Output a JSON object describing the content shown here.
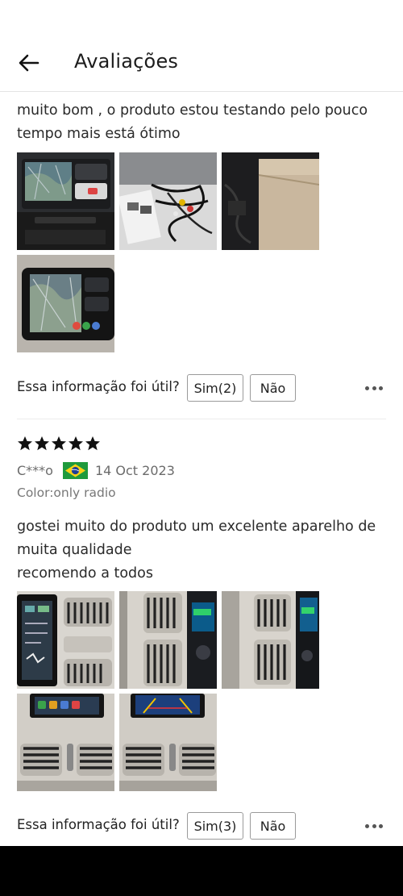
{
  "header": {
    "back_icon": "arrow-left-icon",
    "title": "Avaliações"
  },
  "review1": {
    "text_lines": [
      "muito bom , o produto estou testando pelo pouco",
      "tempo mais está ótimo"
    ],
    "photo_count": 4,
    "helpful": {
      "question": "Essa informação foi útil?",
      "yes_label": "Sim(2)",
      "no_label": "Não",
      "more_icon": "more-horizontal-icon"
    }
  },
  "review2": {
    "rating": 5,
    "reviewer": "C***o",
    "country_flag": "brazil-flag-icon",
    "date": "14 Oct 2023",
    "variant": "Color:only radio",
    "text_lines": [
      "gostei muito do produto um excelente aparelho de",
      "muita qualidade",
      "recomendo a todos"
    ],
    "photo_count": 5,
    "helpful": {
      "question": "Essa informação foi útil?",
      "yes_label": "Sim(3)",
      "no_label": "Não",
      "more_icon": "more-horizontal-icon"
    }
  },
  "colors": {
    "star": "#111111",
    "border": "#9a9a9a",
    "muted_text": "#6b6b6b",
    "bottom_bar": "#000000"
  }
}
